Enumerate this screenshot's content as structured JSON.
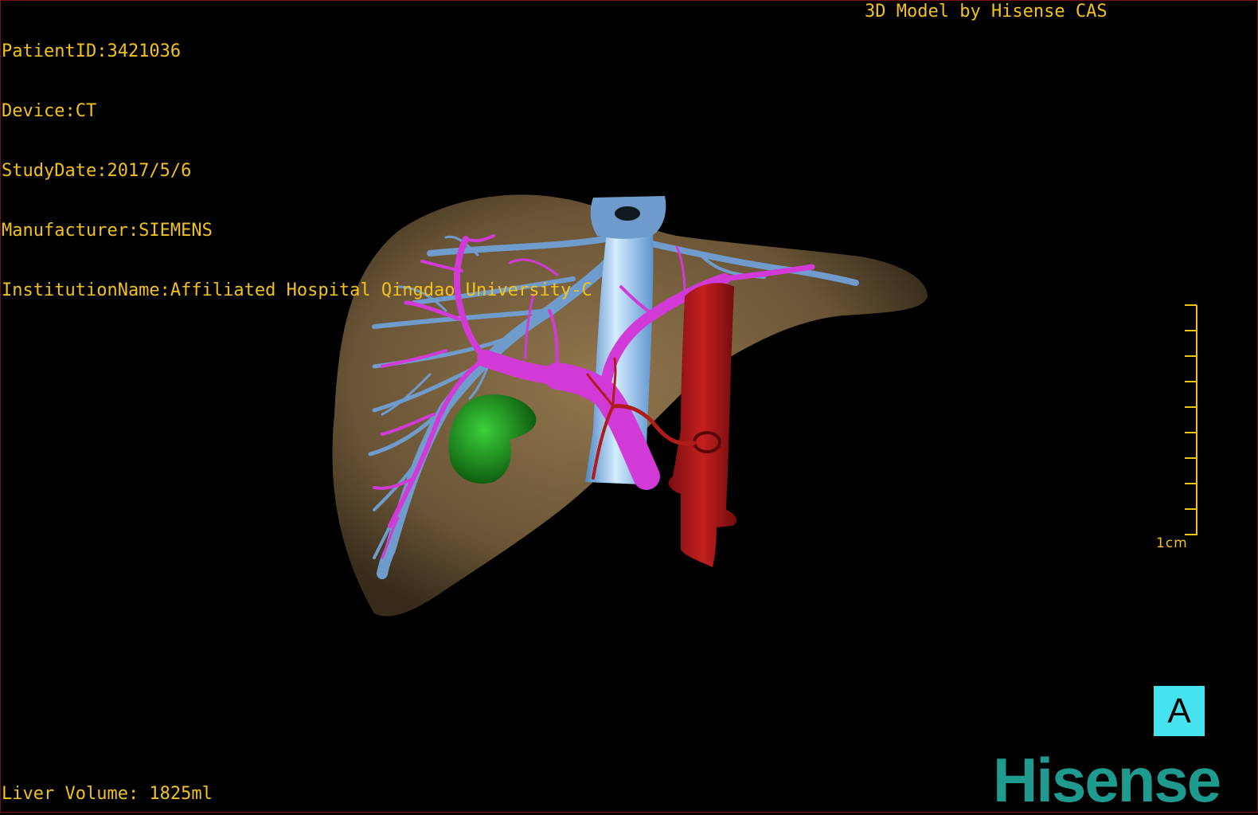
{
  "dicom_info": {
    "patient_id": "PatientID:3421036",
    "device": "Device:CT",
    "study_date": "StudyDate:2017/5/6",
    "manufacturer": "Manufacturer:SIEMENS",
    "institution": "InstitutionName:Affiliated Hospital Qingdao University-C"
  },
  "credit": "3D Model by Hisense CAS",
  "liver_volume": "Liver Volume: 1825ml",
  "scale_bar": {
    "label": "1cm"
  },
  "orientation_label": "A",
  "brand": "Hisense",
  "colors": {
    "text": "#f2c21a",
    "liver": "#7a6342",
    "portal_vein": "#d23ad8",
    "hepatic_vein": "#6f9ccc",
    "ivc": "#8fc2ec",
    "aorta": "#a01818",
    "gallbladder": "#1f8a1f",
    "orientation_bg": "#45e3f0",
    "brand": "#1f9a8f"
  }
}
